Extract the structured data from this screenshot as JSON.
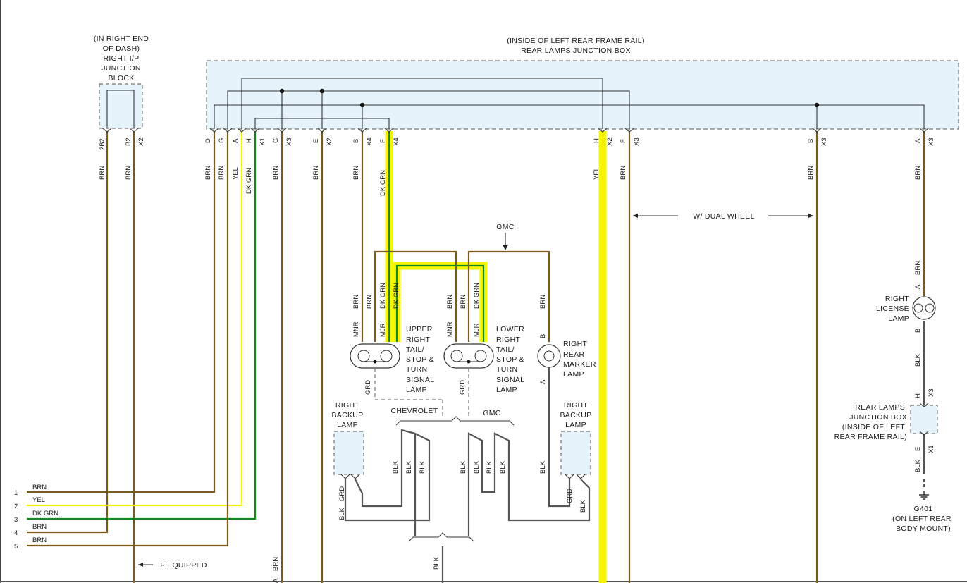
{
  "colors": {
    "brn": "#7a5a1e",
    "blk": "#555555",
    "yel": "#f5f20a",
    "dk_grn": "#128a1e",
    "highlight": "#f5f500",
    "junction_fill": "#e6f3fb",
    "junction_border": "#777777"
  },
  "components": {
    "ip_block": [
      "(IN RIGHT END",
      "OF DASH)",
      "RIGHT I/P",
      "JUNCTION",
      "BLOCK"
    ],
    "rear_box": [
      "(INSIDE OF LEFT REAR FRAME RAIL)",
      "REAR LAMPS JUNCTION BOX"
    ],
    "upper_lamp": [
      "UPPER",
      "RIGHT",
      "TAIL/",
      "STOP &",
      "TURN",
      "SIGNAL",
      "LAMP"
    ],
    "lower_lamp": [
      "LOWER",
      "RIGHT",
      "TAIL/",
      "STOP &",
      "TURN",
      "SIGNAL",
      "LAMP"
    ],
    "marker_lamp": [
      "RIGHT",
      "REAR",
      "MARKER",
      "LAMP"
    ],
    "backup_left": [
      "RIGHT",
      "BACKUP",
      "LAMP"
    ],
    "backup_right": [
      "RIGHT",
      "BACKUP",
      "LAMP"
    ],
    "license_lamp": [
      "RIGHT",
      "LICENSE",
      "LAMP"
    ],
    "rear_box_small": [
      "REAR LAMPS",
      "JUNCTION BOX",
      "(INSIDE OF LEFT",
      "REAR FRAME RAIL)"
    ],
    "ground": [
      "G401",
      "(ON LEFT REAR",
      "BODY MOUNT)"
    ]
  },
  "notes": {
    "gmc_top": "GMC",
    "chevrolet": "CHEVROLET",
    "gmc_bottom": "GMC",
    "dual_wheel": "W/ DUAL WHEEL",
    "if_equipped": "IF EQUIPPED"
  },
  "ip_pins": [
    {
      "pin": "2B2",
      "wire": "BRN"
    },
    {
      "pin": "B2",
      "conn": "X2",
      "wire": "BRN"
    }
  ],
  "box_pins": [
    {
      "pin": "D",
      "wire": "BRN"
    },
    {
      "pin": "G",
      "wire": "BRN"
    },
    {
      "pin": "A",
      "wire": "YEL"
    },
    {
      "pin": "H",
      "conn": "X1",
      "wire": "DK GRN"
    },
    {
      "pin": "G",
      "conn": "X3",
      "wire": "BRN"
    },
    {
      "pin": "E",
      "conn": "X2",
      "wire": "BRN"
    },
    {
      "pin": "B",
      "conn": "X4",
      "wire": "BRN"
    },
    {
      "pin": "F",
      "conn": "X4",
      "wire": "DK GRN"
    },
    {
      "pin": "H",
      "conn": "X2",
      "wire": "YEL"
    },
    {
      "pin": "F",
      "conn": "X3",
      "wire": "BRN"
    },
    {
      "pin": "B",
      "conn": "X3",
      "wire": "BRN"
    },
    {
      "pin": "A",
      "conn": "X3",
      "wire": "BRN"
    }
  ],
  "lamp_wire_labels": {
    "upper": [
      "BRN",
      "BRN",
      "DK GRN",
      "DK GRN"
    ],
    "lower": [
      "BRN",
      "BRN",
      "DK GRN"
    ],
    "marker": "BRN",
    "upper_pins": [
      "MNR",
      "MJR"
    ],
    "lower_pins": [
      "MNR",
      "MJR"
    ],
    "marker_pins": [
      "B",
      "A"
    ],
    "grd": "GRD"
  },
  "backup_wires": {
    "left_pins": [
      "BLK",
      "GRD"
    ],
    "right_pins": [
      "GRD",
      "BLK"
    ],
    "blk": "BLK"
  },
  "license_wires": {
    "top": "BRN",
    "pin_a": "A",
    "pin_b": "B",
    "mid": "BLK",
    "pin_h": "H",
    "conn_h": "X3",
    "pin_e": "E",
    "conn_e": "X1",
    "bottom": "BLK"
  },
  "left_harness": [
    {
      "num": "1",
      "wire": "BRN"
    },
    {
      "num": "2",
      "wire": "YEL"
    },
    {
      "num": "3",
      "wire": "DK GRN"
    },
    {
      "num": "4",
      "wire": "BRN"
    },
    {
      "num": "5",
      "wire": "BRN"
    }
  ],
  "bottom_labels": {
    "brn": "BRN",
    "blk": "BLK",
    "a": "A"
  }
}
